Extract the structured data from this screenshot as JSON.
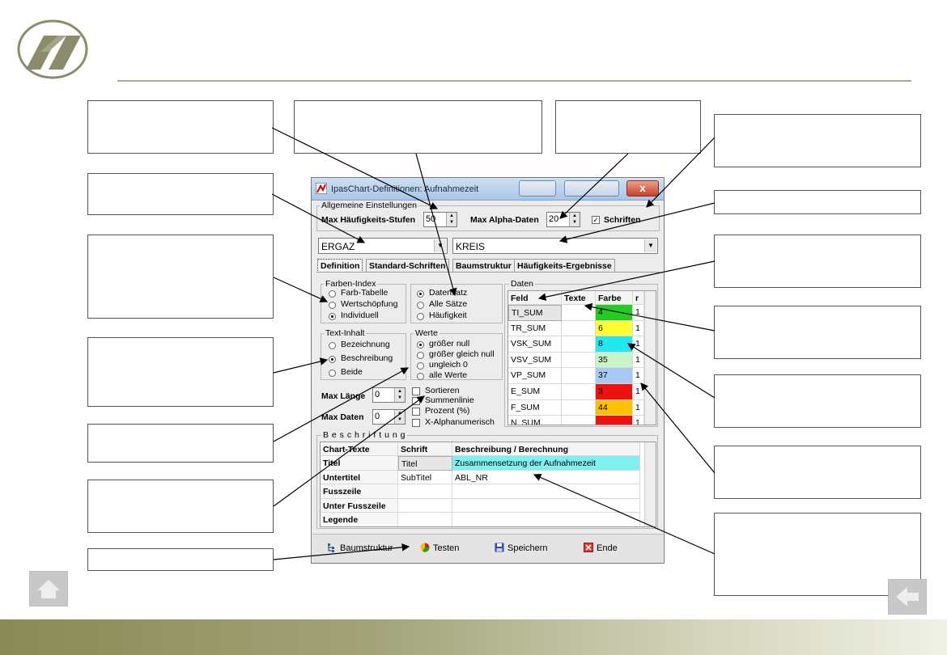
{
  "dialog": {
    "title": "IpasChart-Definitionen: Aufnahmezeit",
    "close_glyph": "x",
    "general": {
      "legend": "Allgemeine Einstellungen",
      "max_freq_label": "Max Häufigkeits-Stufen",
      "max_freq_value": "50",
      "max_alpha_label": "Max Alpha-Daten",
      "max_alpha_value": "20",
      "fonts_checkbox_label": "Schriften",
      "fonts_checked": true
    },
    "combo_left": "ERGAZ",
    "combo_right": "KREIS",
    "tabs": [
      "Definition",
      "Standard-Schriften",
      "Baumstruktur",
      "Häufigkeits-Ergebnisse"
    ],
    "color_index": {
      "legend": "Farben-Index",
      "options": [
        "Farb-Tabelle",
        "Wertschöpfung",
        "Individuell"
      ],
      "selected": 2
    },
    "record_scope": {
      "options": [
        "Datensatz",
        "Alle Sätze",
        "Häufigkeit"
      ],
      "selected": 0
    },
    "text_content": {
      "legend": "Text-Inhalt",
      "options": [
        "Bezeichnung",
        "Beschreibung",
        "Beide"
      ],
      "selected": 1
    },
    "values": {
      "legend": "Werte",
      "options": [
        "größer null",
        "größer gleich null",
        "ungleich 0",
        "alle Werte"
      ],
      "selected": 0
    },
    "max_length_label": "Max Länge",
    "max_length_value": "0",
    "max_data_label": "Max Daten",
    "max_data_value": "0",
    "checkboxes": [
      "Sortieren",
      "Summenlinie",
      "Prozent (%)",
      "X-Alphanumerisch"
    ],
    "data_grid": {
      "legend": "Daten",
      "headers": [
        "Feld",
        "Texte",
        "Farbe",
        "r"
      ],
      "rows": [
        {
          "feld": "TI_SUM",
          "texte": "",
          "farbe": "4",
          "color": "#22cc22",
          "r": "1"
        },
        {
          "feld": "TR_SUM",
          "texte": "",
          "farbe": "6",
          "color": "#ffff33",
          "r": "1"
        },
        {
          "feld": "VSK_SUM",
          "texte": "",
          "farbe": "8",
          "color": "#22e6f0",
          "r": "1"
        },
        {
          "feld": "VSV_SUM",
          "texte": "",
          "farbe": "35",
          "color": "#c8f5c8",
          "r": "1"
        },
        {
          "feld": "VP_SUM",
          "texte": "",
          "farbe": "37",
          "color": "#a8c8f5",
          "r": "1"
        },
        {
          "feld": "E_SUM",
          "texte": "",
          "farbe": "3",
          "color": "#ee1111",
          "r": "1"
        },
        {
          "feld": "F_SUM",
          "texte": "",
          "farbe": "44",
          "color": "#ffc000",
          "r": "1"
        },
        {
          "feld": "N_SUM",
          "texte": "",
          "farbe": "",
          "color": "#ee1111",
          "r": "1"
        }
      ]
    },
    "labels_grid": {
      "legend": "B e s c h r i f t u n g",
      "headers": [
        "Chart-Texte",
        "Schrift",
        "Beschreibung / Berechnung"
      ],
      "rows": [
        {
          "name": "Titel",
          "font": "Titel",
          "desc": "Zusammensetzung der Aufnahmezeit",
          "highlight": "#7ff0f0"
        },
        {
          "name": "Untertitel",
          "font": "SubTitel",
          "desc": "ABL_NR",
          "highlight": ""
        },
        {
          "name": "Fusszeile",
          "font": "",
          "desc": "",
          "highlight": ""
        },
        {
          "name": "Unter Fusszeile",
          "font": "",
          "desc": "",
          "highlight": ""
        },
        {
          "name": "Legende",
          "font": "",
          "desc": "",
          "highlight": ""
        }
      ]
    },
    "buttons": {
      "tree": "Baumstruktur",
      "test": "Testen",
      "save": "Speichern",
      "end": "Ende"
    }
  },
  "colors": {
    "accent_rule": "#a8ad8a",
    "nav_gray": "#c8c8c8"
  }
}
